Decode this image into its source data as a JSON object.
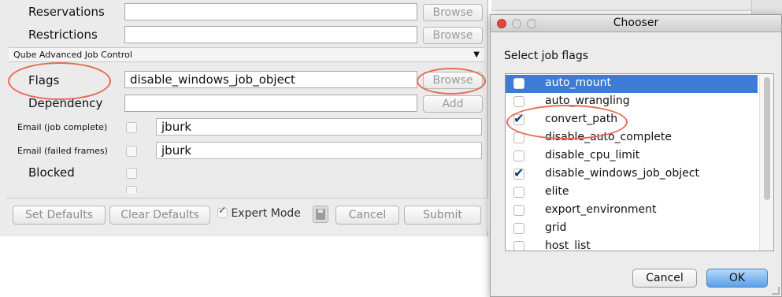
{
  "main": {
    "rows": {
      "reservations": {
        "label": "Reservations",
        "value": "",
        "button": "Browse"
      },
      "restrictions": {
        "label": "Restrictions",
        "value": "",
        "button": "Browse"
      },
      "flags": {
        "label": "Flags",
        "value": "disable_windows_job_object",
        "button": "Browse"
      },
      "dependency": {
        "label": "Dependency",
        "value": "",
        "button": "Add"
      },
      "email_complete": {
        "label": "Email (job complete)",
        "value": "jburk"
      },
      "email_failed": {
        "label": "Email (failed frames)",
        "value": "jburk"
      },
      "blocked": {
        "label": "Blocked"
      }
    },
    "section_header": "Qube Advanced Job Control",
    "section_arrow": "▼",
    "bottom": {
      "set_defaults": "Set Defaults",
      "clear_defaults": "Clear Defaults",
      "expert_mode": "Expert Mode",
      "expert_mode_checked": true,
      "cancel": "Cancel",
      "submit": "Submit"
    }
  },
  "chooser": {
    "title": "Chooser",
    "prompt": "Select job flags",
    "flags": [
      {
        "label": "auto_mount",
        "checked": false,
        "selected": true
      },
      {
        "label": "auto_wrangling",
        "checked": false,
        "selected": false
      },
      {
        "label": "convert_path",
        "checked": true,
        "selected": false
      },
      {
        "label": "disable_auto_complete",
        "checked": false,
        "selected": false
      },
      {
        "label": "disable_cpu_limit",
        "checked": false,
        "selected": false
      },
      {
        "label": "disable_windows_job_object",
        "checked": true,
        "selected": false
      },
      {
        "label": "elite",
        "checked": false,
        "selected": false
      },
      {
        "label": "export_environment",
        "checked": false,
        "selected": false
      },
      {
        "label": "grid",
        "checked": false,
        "selected": false
      },
      {
        "label": "host_list",
        "checked": false,
        "selected": false
      }
    ],
    "cancel": "Cancel",
    "ok": "OK"
  },
  "colors": {
    "annotation": "#e86a55",
    "selection": "#3d7bd6",
    "ok_button": "#5aa0ea"
  },
  "icons": {
    "close": "close-icon",
    "minimize": "minimize-icon",
    "zoom": "zoom-icon",
    "save": "save-icon",
    "checkmark": "checkmark-icon",
    "dropdown": "chevron-down-icon"
  }
}
